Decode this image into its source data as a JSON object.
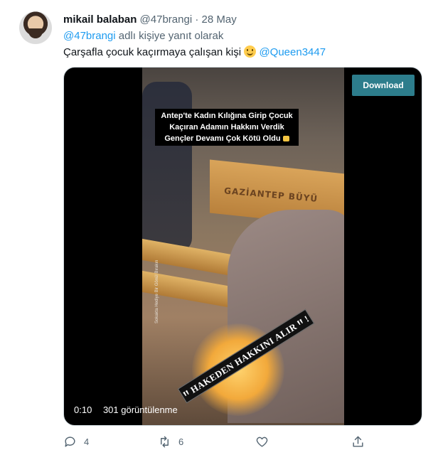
{
  "tweet": {
    "author_name": "mikail balaban",
    "author_handle": "@47brangi",
    "separator": "·",
    "date": "28 May",
    "reply_prefix": "@47brangi",
    "reply_suffix": "adlı kişiye yanıt olarak",
    "text": "Çarşafla çocuk kaçırmaya çalışan kişi",
    "emoji": "slightly-smiling-face-emoji",
    "mention": "@Queen3447"
  },
  "media": {
    "download_label": "Download",
    "caption_lines": [
      "Antep'te Kadın Kılığına Girip Çocuk",
      "Kaçıran Adamın Hakkını Verdik",
      "Gençler Devamı Çok Kötü Oldu"
    ],
    "bench_text": "GAZİANTEP BÜYÜ",
    "overlay_text": "ꞋꞋ HAKEDEN HAKKINI ALIR ꞋꞋ !",
    "sign_text": "Sokakta Hediye Bir Gönül Bırakın",
    "elapsed": "0:10",
    "views": "301 görüntülenme"
  },
  "actions": {
    "reply_count": "4",
    "retweet_count": "6",
    "like_count": "",
    "share_count": ""
  },
  "colors": {
    "accent": "#1d9bf0",
    "secondary_text": "#536471",
    "download_button": "#2d7d8c"
  }
}
